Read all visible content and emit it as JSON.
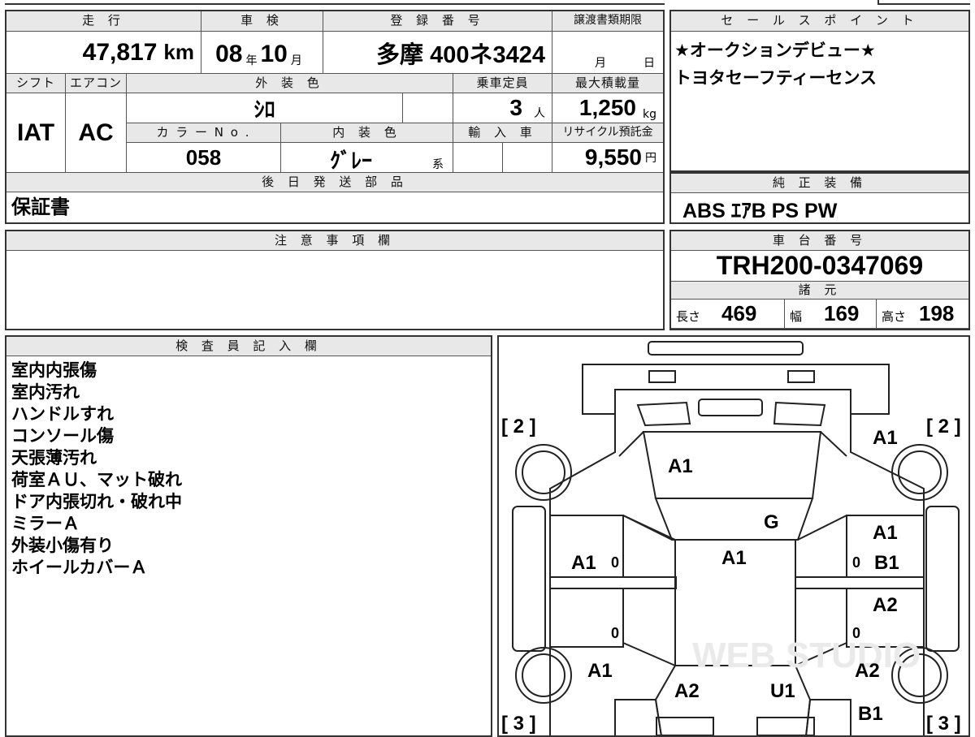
{
  "top_table": {
    "mileage_header": "走 行",
    "mileage_value": "47,817",
    "mileage_unit": "km",
    "inspection_header": "車 検",
    "inspection_year": "08",
    "inspection_year_unit": "年",
    "inspection_month": "10",
    "inspection_month_unit": "月",
    "registration_header": "登 録 番 号",
    "registration_value": "多摩 400ネ3424",
    "transfer_header": "譲渡書類期限",
    "transfer_month_unit": "月",
    "transfer_day_unit": "日",
    "shift_header": "シフト",
    "shift_value": "IAT",
    "ac_header": "エアコン",
    "ac_value": "AC",
    "exterior_header": "外 装 色",
    "exterior_value": "ｼﾛ",
    "capacity_header": "乗車定員",
    "capacity_value": "3",
    "capacity_unit": "人",
    "maxload_header": "最大積載量",
    "maxload_value": "1,250",
    "maxload_unit": "kg",
    "colorno_header": "カ ラ ー N o .",
    "colorno_value": "058",
    "interior_header": "内 装 色",
    "interior_value": "ｸﾞﾚｰ",
    "interior_suffix": "系",
    "import_header": "輸 入 車",
    "recycle_header": "リサイクル預託金",
    "recycle_value": "9,550",
    "recycle_unit": "円",
    "later_parts_header": "後 日 発 送 部 品",
    "later_parts_value": "保証書"
  },
  "sales_point": {
    "header": "セ ー ル ス ポ イ ン ト",
    "lines": [
      "★オークションデビュー★",
      "トヨタセーフティーセンス"
    ]
  },
  "genuine_equipment": {
    "header": "純 正 装 備",
    "value": "ABS ｴｱB PS PW"
  },
  "notes": {
    "header": "注 意 事 項 欄"
  },
  "chassis": {
    "header": "車 台 番 号",
    "value": "TRH200-0347069",
    "specs_header": "諸 元",
    "length_label": "長さ",
    "length_value": "469",
    "width_label": "幅",
    "width_value": "169",
    "height_label": "高さ",
    "height_value": "198"
  },
  "inspector": {
    "header": "検 査 員 記 入 欄",
    "remarks": [
      "室内内張傷",
      "室内汚れ",
      "ハンドルすれ",
      "コンソール傷",
      "天張薄汚れ",
      "荷室ＡＵ、マット破れ",
      "ドア内張切れ・破れ中",
      "ミラーＡ",
      "外装小傷有り",
      "ホイールカバーＡ"
    ]
  },
  "diagram": {
    "tire_front_left": "[ 2 ]",
    "tire_front_right": "[ 2 ]",
    "tire_rear_left": "[ 3 ]",
    "tire_rear_right": "[ 3 ]",
    "marks": {
      "hood": "A1",
      "front_right_fender": "A1",
      "windshield": "G",
      "roof": "A1",
      "front_left_door": "A1",
      "front_right_door_1": "A1",
      "front_right_door_2": "B1",
      "rear_right_door": "A2",
      "rear_left_quarter": "A1",
      "rear_right_quarter": "A2",
      "rear_body_left": "A2",
      "rear_body_right": "U1",
      "rear_right_corner": "B1"
    },
    "door_marks": [
      "0",
      "0",
      "0",
      "0"
    ],
    "watermark": "WEB STUDIO"
  }
}
